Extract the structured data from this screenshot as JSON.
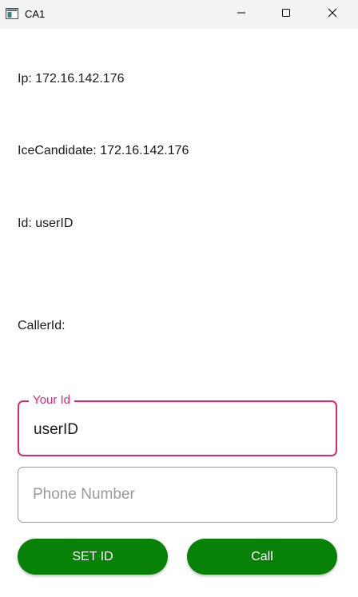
{
  "window": {
    "title": "CA1",
    "icon": "app-window-icon",
    "controls": [
      "minimize-icon",
      "maximize-icon",
      "close-icon"
    ]
  },
  "info": {
    "ip_label": "Ip:",
    "ip_value": "172.16.142.176",
    "ice_label": "IceCandidate:",
    "ice_value": "172.16.142.176",
    "id_label": "Id:",
    "id_value": "userID",
    "caller_label": "CallerId:",
    "caller_value": ""
  },
  "your_id_field": {
    "label": "Your Id",
    "value": "userID"
  },
  "phone_field": {
    "placeholder": "Phone Number",
    "value": ""
  },
  "buttons": {
    "set_id": "SET ID",
    "call": "Call"
  },
  "colors": {
    "accent": "#e5266f",
    "button_green": "#078207",
    "titlebar": "#f3f3f3"
  }
}
